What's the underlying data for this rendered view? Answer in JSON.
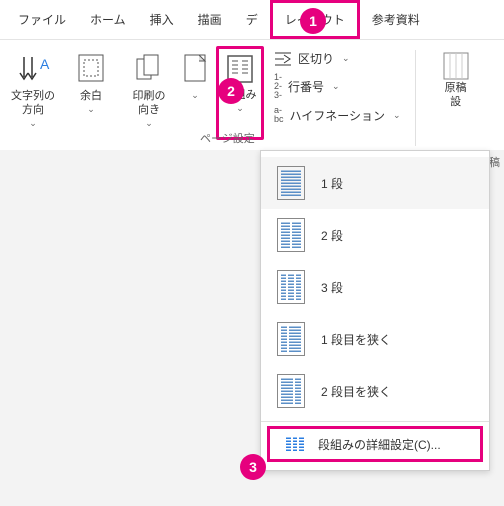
{
  "tabs": {
    "file": "ファイル",
    "home": "ホーム",
    "insert": "挿入",
    "draw": "描画",
    "design": "デ",
    "layout": "レイアウト",
    "references": "参考資料"
  },
  "ribbon": {
    "text_direction": "文字列の\n方向",
    "margins": "余白",
    "orientation": "印刷の\n向き",
    "size_caret": "⌄",
    "columns": "段組み",
    "breaks": "区切り",
    "line_numbers": "行番号",
    "hyphenation": "ハイフネーション",
    "section_label": "ページ設定",
    "right": {
      "line1": "原稿",
      "line2": "設",
      "line3": "稿"
    }
  },
  "dropdown": {
    "one": "1 段",
    "two": "2 段",
    "three": "3 段",
    "left": "1 段目を狭く",
    "right": "2 段目を狭く",
    "more": "段組みの詳細設定(C)..."
  },
  "badges": {
    "b1": "1",
    "b2": "2",
    "b3": "3"
  }
}
